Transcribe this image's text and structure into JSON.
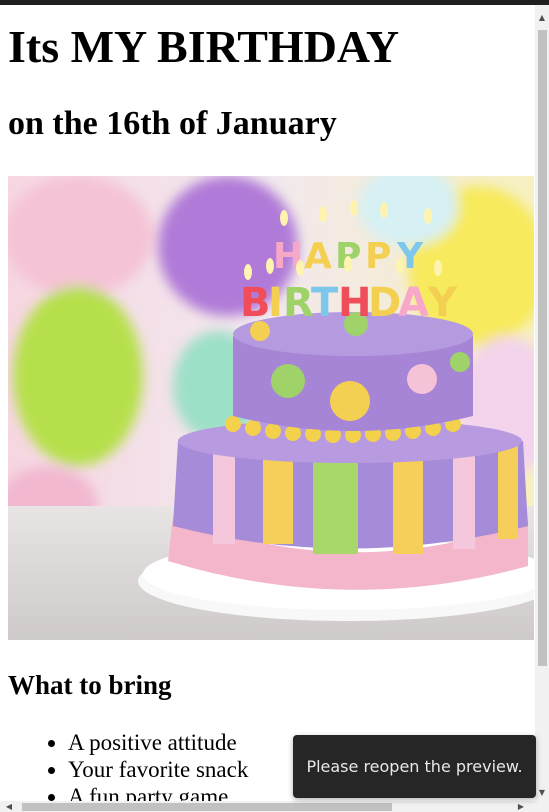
{
  "page": {
    "title": "Its MY BIRTHDAY",
    "subtitle": "on the 16th of January"
  },
  "image": {
    "alt_icon": "birthday-cake-image",
    "cake_topper_line1": "HAPPY",
    "cake_topper_line2": "BIRTHDAY"
  },
  "section": {
    "heading": "What to bring",
    "items": [
      "A positive attitude",
      "Your favorite snack",
      "A fun party game"
    ]
  },
  "toast": {
    "message": "Please reopen the preview."
  },
  "colors": {
    "topbar": "#1f1f1f",
    "toast_bg": "#262626",
    "scroll_thumb": "#c1c1c1"
  }
}
